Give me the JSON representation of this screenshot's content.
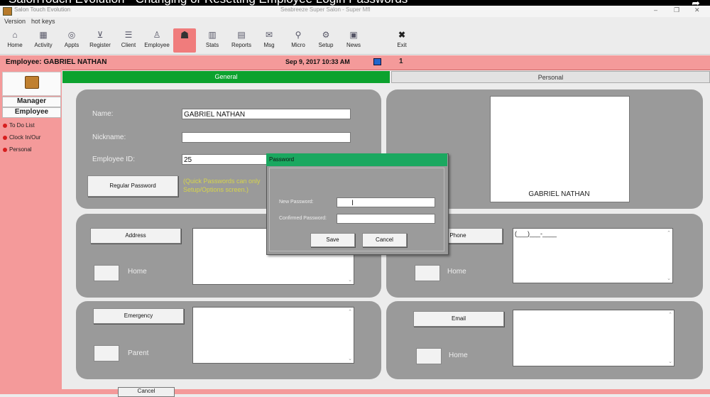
{
  "video_title": "SalonTouch Evolution - Changing or Resetting Employee Login Passwords",
  "window": {
    "app_title": "Salon Touch Evolution",
    "title": "Seabreeze Super Salon - Super Mfl"
  },
  "menu": {
    "items": [
      "Version",
      "hot keys"
    ]
  },
  "toolbar": {
    "items": [
      {
        "label": "Home",
        "icon": "home-icon"
      },
      {
        "label": "Activity",
        "icon": "activity-icon"
      },
      {
        "label": "Appts",
        "icon": "appointments-icon"
      },
      {
        "label": "Register",
        "icon": "cart-icon"
      },
      {
        "label": "Client",
        "icon": "client-icon"
      },
      {
        "label": "Employee",
        "icon": "employee-icon"
      },
      {
        "label": "",
        "icon": "employee-login-icon"
      },
      {
        "label": "Stats",
        "icon": "stats-icon"
      },
      {
        "label": "Reports",
        "icon": "reports-icon"
      },
      {
        "label": "Msg",
        "icon": "message-icon"
      },
      {
        "label": "Micro",
        "icon": "micro-icon"
      },
      {
        "label": "Setup",
        "icon": "setup-icon"
      },
      {
        "label": "News",
        "icon": "news-icon"
      },
      {
        "label": "Exit",
        "icon": "exit-icon"
      }
    ]
  },
  "employee_bar": {
    "label": "Employee:  GABRIEL  NATHAN",
    "datetime": "Sep  9,  2017  10:33 AM",
    "count": "1"
  },
  "sidebar": {
    "tabs": [
      "Manager",
      "Employee"
    ],
    "items": [
      "To Do List",
      "Clock In/Our",
      "Personal"
    ],
    "accent": "#f49a9a"
  },
  "tabs": {
    "general": "General",
    "personal": "Personal",
    "active_color": "#0ca22e"
  },
  "form": {
    "name_label": "Name:",
    "name_value": "GABRIEL NATHAN",
    "nickname_label": "Nickname:",
    "nickname_value": "",
    "employee_id_label": "Employee ID:",
    "employee_id_value": "25",
    "regular_password_button": "Regular Password",
    "quick_password_hint_1": "(Quick Passwords can only",
    "quick_password_hint_2": "Setup/Options screen.)",
    "photo_name": "GABRIEL NATHAN",
    "address_button": "Address",
    "address_home_label": "Home",
    "emergency_button": "Emergency",
    "emergency_parent_label": "Parent",
    "phone_button": "Phone",
    "phone_home_label": "Home",
    "phone_value": "(___)___-____",
    "email_button": "Email",
    "email_home_label": "Home"
  },
  "password_dialog": {
    "title": "Password",
    "new_password_label": "New Password:",
    "confirm_password_label": "Confirmed Password:",
    "new_password_value": "",
    "confirm_password_value": "",
    "save_button": "Save",
    "cancel_button": "Cancel"
  },
  "bottom": {
    "button_label": "Cancel"
  }
}
